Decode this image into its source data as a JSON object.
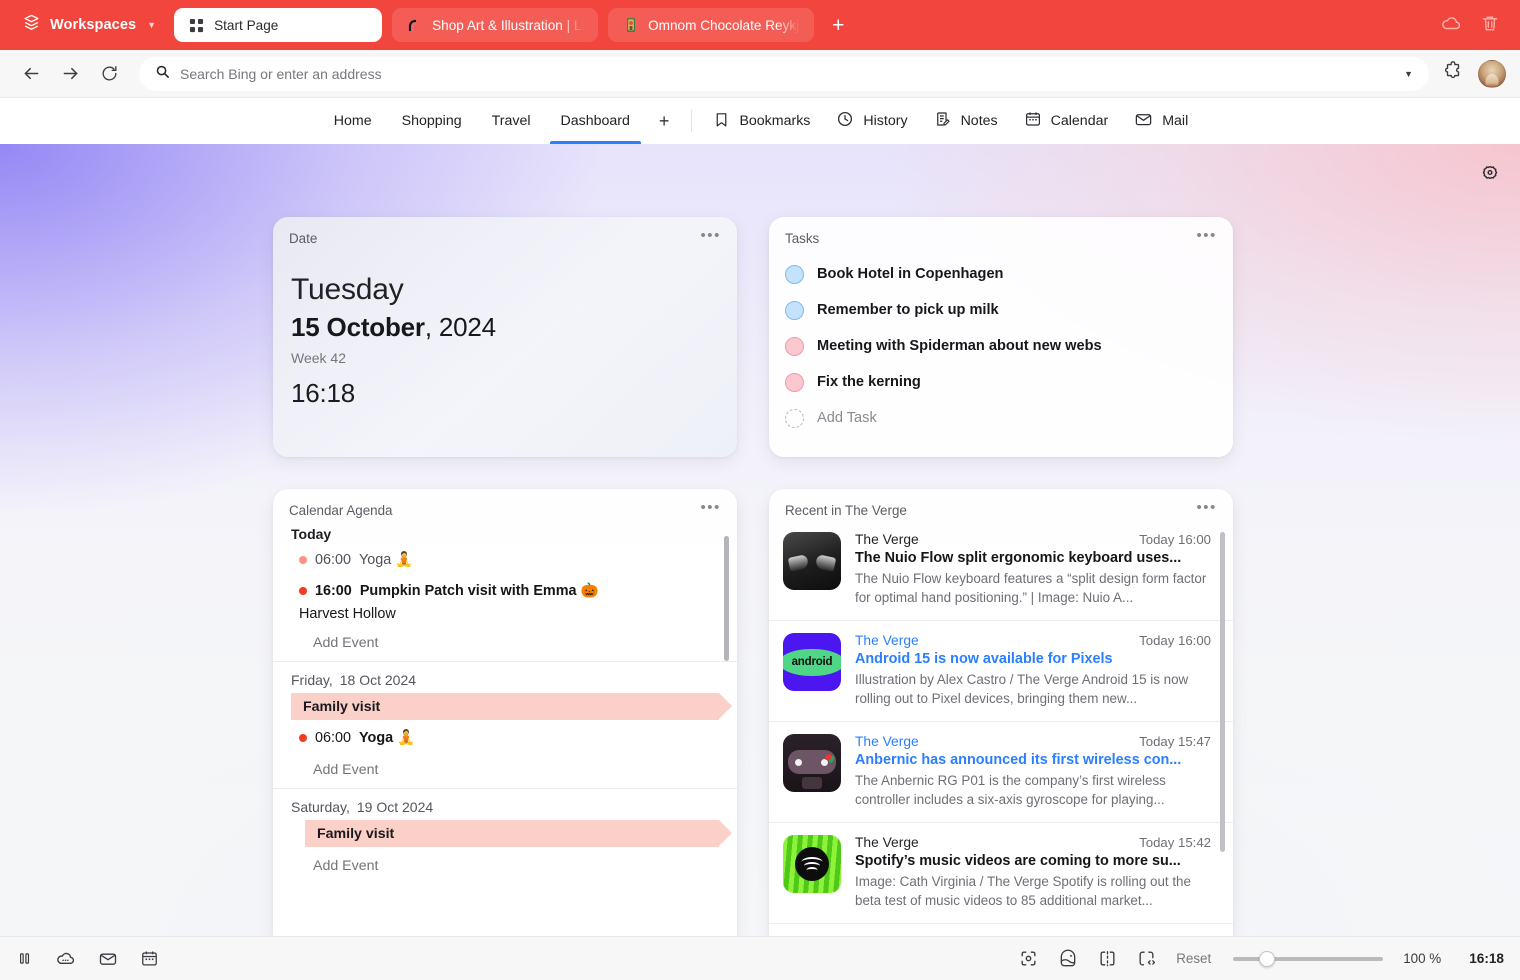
{
  "tabbar": {
    "workspaces_label": "Workspaces",
    "tabs": [
      {
        "title": "Start Page",
        "favicon": "grid-icon",
        "active": true
      },
      {
        "title": "Shop Art & Illustration | Lis",
        "favicon": "arc-swatch-icon",
        "active": false
      },
      {
        "title": "Omnom Chocolate Reykjav",
        "favicon": "chocolate-icon",
        "active": false
      }
    ],
    "new_tab_label": "+",
    "right_icons": [
      "cloud-icon",
      "trash-icon"
    ],
    "accent_color": "#f2453d"
  },
  "navbar": {
    "back_icon": "arrow-left-icon",
    "forward_icon": "arrow-right-icon",
    "reload_icon": "reload-icon",
    "search_icon": "search-icon",
    "omnibox_placeholder": "Search Bing or enter an address",
    "omnibox_value": "",
    "dropdown_icon": "chevron-down-icon",
    "extensions_icon": "puzzle-icon",
    "profile_icon": "avatar"
  },
  "dashnav": {
    "pages": [
      {
        "label": "Home",
        "active": false
      },
      {
        "label": "Shopping",
        "active": false
      },
      {
        "label": "Travel",
        "active": false
      },
      {
        "label": "Dashboard",
        "active": true
      }
    ],
    "add_page_label": "+",
    "tools": [
      {
        "label": "Bookmarks",
        "icon": "bookmark-icon"
      },
      {
        "label": "History",
        "icon": "history-icon"
      },
      {
        "label": "Notes",
        "icon": "notes-icon"
      },
      {
        "label": "Calendar",
        "icon": "calendar-icon"
      },
      {
        "label": "Mail",
        "icon": "mail-icon"
      }
    ],
    "active_underline_color": "#2b7fff"
  },
  "canvas": {
    "settings_icon": "gear-icon"
  },
  "date_card": {
    "title": "Date",
    "menu_icon": "more-dots-icon",
    "weekday": "Tuesday",
    "day_month": "15 October",
    "year_suffix": ", 2024",
    "week": "Week 42",
    "time": "16:18"
  },
  "tasks_card": {
    "title": "Tasks",
    "menu_icon": "more-dots-icon",
    "items": [
      {
        "label": "Book Hotel in Copenhagen",
        "color": "blue"
      },
      {
        "label": "Remember to pick up milk",
        "color": "blue"
      },
      {
        "label": "Meeting with Spiderman about new webs",
        "color": "pink"
      },
      {
        "label": "Fix the kerning",
        "color": "pink"
      }
    ],
    "add_label": "Add Task",
    "colors": {
      "blue": "#c4e2fb",
      "pink": "#fbc8d0"
    }
  },
  "agenda_card": {
    "title": "Calendar Agenda",
    "menu_icon": "more-dots-icon",
    "add_event_label": "Add Event",
    "sections": [
      {
        "day_label": "Today",
        "weekday": "",
        "date": "",
        "is_today": true,
        "allday": null,
        "events": [
          {
            "time": "06:00",
            "name": "Yoga 🧘",
            "dot": "soft",
            "bold": false,
            "sub": ""
          },
          {
            "time": "16:00",
            "name": "Pumpkin Patch visit with Emma 🎃",
            "dot": "strong",
            "bold": true,
            "sub": "Harvest Hollow"
          }
        ]
      },
      {
        "day_label": "",
        "weekday": "Friday,",
        "date": "18 Oct 2024",
        "is_today": false,
        "allday": "Family visit",
        "events": [
          {
            "time": "06:00",
            "name": "Yoga 🧘",
            "dot": "strong",
            "bold": true,
            "sub": ""
          }
        ]
      },
      {
        "day_label": "",
        "weekday": "Saturday,",
        "date": "19 Oct 2024",
        "is_today": false,
        "allday": "Family visit",
        "events": []
      }
    ]
  },
  "news_card": {
    "title": "Recent in The Verge",
    "menu_icon": "more-dots-icon",
    "items": [
      {
        "source": "The Verge",
        "time": "Today 16:00",
        "headline": "The Nuio Flow split ergonomic keyboard uses...",
        "description": "The Nuio Flow keyboard features a “split design form factor for optimal hand positioning.” | Image: Nuio A...",
        "read": false,
        "thumb": "keyboard-thumb"
      },
      {
        "source": "The Verge",
        "time": "Today 16:00",
        "headline": "Android 15 is now available for Pixels",
        "description": "Illustration by Alex Castro / The Verge Android 15 is now rolling out to Pixel devices, bringing them new...",
        "read": true,
        "thumb": "android-thumb"
      },
      {
        "source": "The Verge",
        "time": "Today 15:47",
        "headline": "Anbernic has announced its first wireless con...",
        "description": "The Anbernic RG P01 is the company’s first wireless controller includes a six-axis gyroscope for playing...",
        "read": true,
        "thumb": "gamepad-thumb"
      },
      {
        "source": "The Verge",
        "time": "Today 15:42",
        "headline": "Spotify’s music videos are coming to more su...",
        "description": "Image: Cath Virginia / The Verge Spotify is rolling out the beta test of music videos to 85 additional market...",
        "read": false,
        "thumb": "spotify-thumb"
      }
    ],
    "link_color": "#2b7fff"
  },
  "statusbar": {
    "left_icons": [
      "pause-icon",
      "cloud-dots-icon",
      "mail-icon",
      "calendar-icon"
    ],
    "right_icons": [
      "capture-icon",
      "globe-icon",
      "split-view-icon",
      "devtools-icon"
    ],
    "reset_label": "Reset",
    "zoom_value": "100 %",
    "clock": "16:18"
  }
}
